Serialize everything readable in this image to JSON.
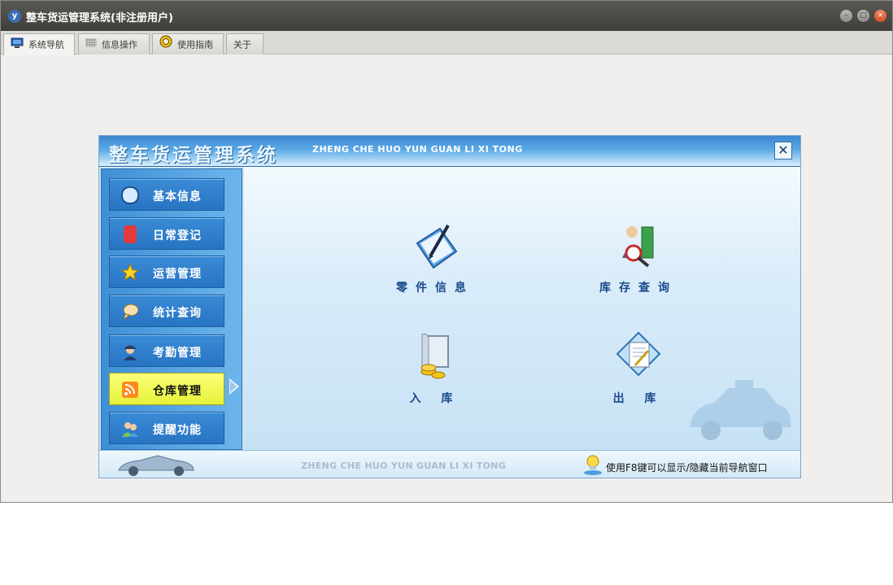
{
  "window": {
    "title": "整车货运管理系统(非注册用户)"
  },
  "tabs": [
    {
      "label": "系统导航",
      "icon": "monitor-icon"
    },
    {
      "label": "信息操作",
      "icon": "grid-icon"
    },
    {
      "label": "使用指南",
      "icon": "lifebuoy-icon"
    },
    {
      "label": "关于"
    }
  ],
  "panel": {
    "title_cn": "整车货运管理系统",
    "title_en": "ZHENG CHE HUO YUN GUAN LI XI TONG",
    "close_glyph": "✕"
  },
  "sidebar": {
    "items": [
      {
        "label": "基本信息",
        "icon": "id-card-icon",
        "color": "#d8ecff"
      },
      {
        "label": "日常登记",
        "icon": "monitor-red-icon",
        "color": "#e23b3b"
      },
      {
        "label": "运营管理",
        "icon": "star-icon",
        "color": "#ffd21f"
      },
      {
        "label": "统计查询",
        "icon": "speech-bubble-icon",
        "color": "#f3e2b0"
      },
      {
        "label": "考勤管理",
        "icon": "officer-icon",
        "color": "#2a3a66"
      },
      {
        "label": "仓库管理",
        "icon": "rss-icon",
        "color": "#ff8a1c",
        "active": true
      },
      {
        "label": "提醒功能",
        "icon": "users-icon",
        "color": "#7bc35a"
      }
    ]
  },
  "functions": [
    {
      "label": "零件信息",
      "icon": "notebook-pen-icon"
    },
    {
      "label": "库存查询",
      "icon": "search-person-icon"
    },
    {
      "label": "入 库",
      "icon": "scroll-coins-icon"
    },
    {
      "label": "出 库",
      "icon": "document-diamond-icon"
    }
  ],
  "footer": {
    "watermark": "ZHENG CHE HUO YUN GUAN LI XI TONG",
    "hint": "使用F8键可以显示/隐藏当前导航窗口"
  },
  "colors": {
    "titlebar": "#4a4945",
    "accent": "#2f7dc9",
    "active_nav": "#eef53f"
  }
}
